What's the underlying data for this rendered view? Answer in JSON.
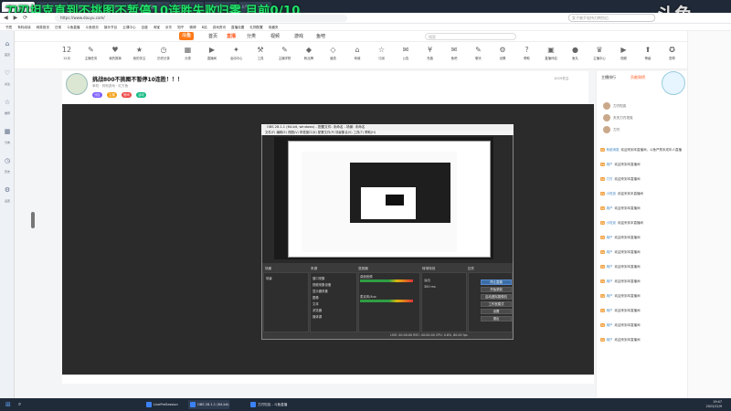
{
  "overlay": {
    "title": "刀刃坦克直到不挑图不暂停10连胜失败归零 目前0/10",
    "watermark": "斗鱼"
  },
  "browser": {
    "tabs": [
      "斗鱼",
      "单机游戏",
      "英雄联盟",
      "云课中心",
      "直播管理",
      "全部直播",
      "万级节奏",
      "人气排行"
    ],
    "url": "https://www.douyu.com/",
    "search_placeholder": "女子被歹徒持刀刺伤后",
    "bookmarks": [
      "书签",
      "有料阅读",
      "网易首页",
      "日常",
      "斗鱼直播",
      "斗鱼首页",
      "娱乐节目",
      "云课中心",
      "百度",
      "淘宝",
      "京东",
      "知乎",
      "微博",
      "B站",
      "游戏资讯",
      "直播设置",
      "礼物配置",
      "收藏夹"
    ]
  },
  "site": {
    "logo": "斗鱼",
    "nav": [
      "首页",
      "直播",
      "分类",
      "视频",
      "游戏",
      "鱼吧"
    ],
    "active_nav": "直播",
    "search_placeholder": "搜索",
    "categories": [
      "12月",
      "主播任务",
      "我的赛事",
      "我的关注",
      "历史记录",
      "分类",
      "直播间",
      "活动中心",
      "工具",
      "主播学院",
      "粉丝牌",
      "道具",
      "商城",
      "订阅",
      "公告",
      "充值",
      "鱼吧",
      "聊天",
      "设置",
      "帮助",
      "直播伴侣",
      "鱼丸",
      "主播中心",
      "视频",
      "等级",
      "勋章",
      "更多"
    ]
  },
  "dock": {
    "items": [
      "首页",
      "关注",
      "推荐",
      "分类",
      "历史",
      "设置"
    ]
  },
  "room": {
    "title": "挑战800不挑图不暂停10连胜！！！",
    "meta": "单机 · 其他游戏 · 红方鱼",
    "tags": [
      "分区",
      "主播",
      "房间",
      "活动"
    ],
    "fans": "1029关注"
  },
  "obs": {
    "title": "OBS 28.1.1 (64-bit, windows) - 配置文件: 未命名 - 场景: 未命名",
    "menu": "文件(F)  编辑(E)  视图(V)  停靠窗口(D)  配置文件(P)  场景集合(S)  工具(T)  帮助(H)",
    "dock_headers": [
      "场景",
      "来源",
      "混音器",
      "转场特效",
      "控件"
    ],
    "scene": "场景",
    "sources": [
      "窗口采集",
      "视频采集设备",
      "显示器采集",
      "图像",
      "文本",
      "浏览器",
      "媒体源"
    ],
    "mixer": [
      "桌面音频",
      "麦克风/Aux"
    ],
    "transition": {
      "type": "淡出",
      "duration": "300 ms"
    },
    "controls": [
      "停止直播",
      "开始录制",
      "启动虚拟摄像机",
      "工作室模式",
      "设置",
      "退出"
    ],
    "status": "LIVE: 00:00:00  REC: 00:00:00  CPU: 0.6%, 60.00 fps"
  },
  "right_panel": {
    "tabs": [
      "主播排行",
      "贡献周榜"
    ],
    "ranks": [
      "刀刃坦克",
      "天天刀刃坦克",
      "刀刃"
    ],
    "chat": [
      {
        "nick": "系统消息",
        "text": "欢迎来到本直播间，斗鱼严禁未成年人直播"
      },
      {
        "nick": "用户",
        "text": "欢迎来到本直播间"
      },
      {
        "nick": "刀刃",
        "text": "欢迎来到本直播间"
      },
      {
        "nick": "小坦克",
        "text": "欢迎来到本直播间"
      },
      {
        "nick": "用户",
        "text": "欢迎来到本直播间"
      },
      {
        "nick": "小坦克",
        "text": "欢迎来到本直播间"
      },
      {
        "nick": "用户",
        "text": "欢迎来到本直播间"
      },
      {
        "nick": "用户",
        "text": "欢迎来到本直播间"
      },
      {
        "nick": "用户",
        "text": "欢迎来到本直播间"
      },
      {
        "nick": "用户",
        "text": "欢迎来到本直播间"
      },
      {
        "nick": "用户",
        "text": "欢迎来到本直播间"
      },
      {
        "nick": "用户",
        "text": "欢迎来到本直播间"
      },
      {
        "nick": "用户",
        "text": "欢迎来到本直播间"
      },
      {
        "nick": "用户",
        "text": "欢迎来到本直播间"
      }
    ]
  },
  "taskbar": {
    "apps": [
      "LivePreSession",
      "OBS 28.1.1 (64-bit)",
      "刀刃坦克 - 斗鱼直播"
    ],
    "time": "19:47",
    "date": "2022/12/9"
  }
}
